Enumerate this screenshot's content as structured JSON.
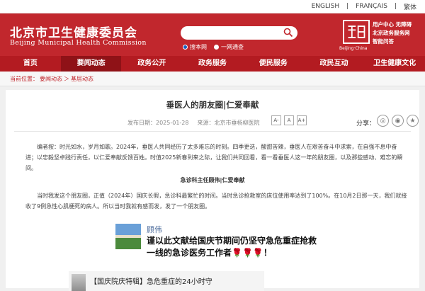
{
  "topbar": {
    "lang_en": "ENGLISH",
    "lang_fr": "FRANÇAIS",
    "lang_cn": "繁体"
  },
  "header": {
    "title_zh": "北京市卫生健康委员会",
    "title_en": "Beijing Municipal Health Commission",
    "search": {
      "placeholder": "",
      "opt_site": "搜本网",
      "opt_all": "一网通查"
    },
    "logo_caption": "Beijing·China",
    "links": [
      "用户中心 无障碍",
      "北京政务服务网",
      "智能问答"
    ]
  },
  "nav": [
    "首页",
    "要闻动态",
    "政务公开",
    "政务服务",
    "便民服务",
    "政民互动",
    "卫生健康文化"
  ],
  "breadcrumb": {
    "current": "当前位置：",
    "level1": "要闻动态",
    "arrow": "＞",
    "level2": "基层动态"
  },
  "article": {
    "title": "垂医人的朋友圈|仁爱奉献",
    "date_label": "发布日期：2025-01-28",
    "source_label": "来源：北京市垂杨柳医院",
    "font_a_small": "A-",
    "font_a": "A",
    "font_a_large": "A+",
    "share_label": "分享：",
    "intro": "编者按：时光如水，岁月如歌。2024年，垂医人共同经历了太多难忘的时刻。四季更迭，酸甜苦辣，垂医人在艰苦奋斗中求索，在自强不息中奋进；以忠毅坚卓践行责任，以仁爱奉献反馈百姓。时值2025新春到来之际，让我们共同回看，看一看垂医人这一年的朋友圈，以及那些感动、难忘的瞬间。",
    "subtitle": "急诊科主任顾伟|仁爱奉献",
    "body": "当时我发这个朋友圈，正值（2024年）国庆长假，急诊科最繁忙的时间。当时急诊抢救室的床位使用率达到了100%。在10月2日那一天，我们就接收了9例急性心肌梗死的病人。所以当时我就有感而发，发了一个朋友圈。",
    "post": {
      "nick": "顾伟",
      "text": "谨以此文献给国庆节期间仍坚守急危重症抢救一线的急诊医务工作者🌹🌹🌹！",
      "card_text": "【国庆院庆特辑】急危重症的24小时守"
    }
  },
  "colors": {
    "brand_red": "#c1272d",
    "nav_red": "#b31b21",
    "nav_active": "#8f1217"
  },
  "icons": {
    "search": "magnifier-icon",
    "wechat": "wechat-icon",
    "weibo": "weibo-icon",
    "qzone": "star-share-icon"
  }
}
